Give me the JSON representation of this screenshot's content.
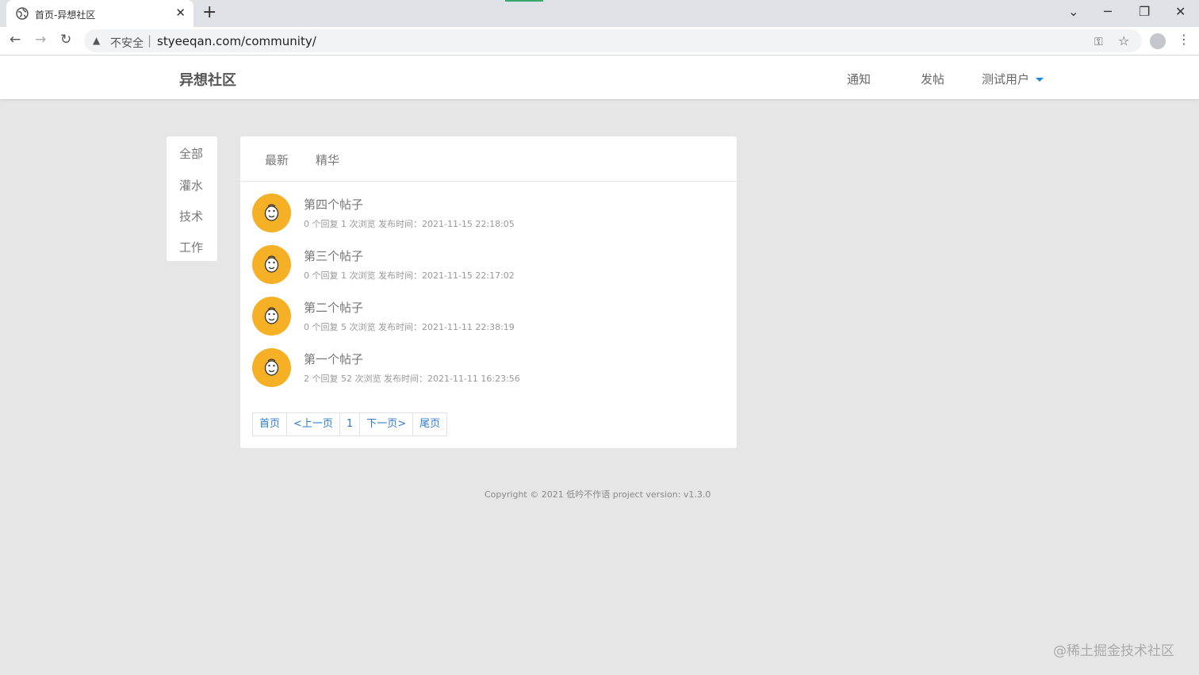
{
  "browser": {
    "tab_title": "首页-异想社区",
    "tab_close": "✕",
    "new_tab": "+",
    "security_label": "不安全",
    "url": "styeeqan.com/community/",
    "window_controls": {
      "dropdown": "⌄",
      "minimize": "─",
      "restore": "❐",
      "close": "✕"
    },
    "nav": {
      "back": "←",
      "forward": "→",
      "reload": "↻"
    },
    "icons": {
      "key": "key-icon",
      "star": "star-icon",
      "profile": "profile-icon",
      "menu": "menu-icon"
    }
  },
  "header": {
    "brand": "异想社区",
    "nav": [
      "通知",
      "发帖",
      "测试用户"
    ]
  },
  "sidebar": {
    "categories": [
      "全部",
      "灌水",
      "技术",
      "工作"
    ]
  },
  "main": {
    "tabs": [
      "最新",
      "精华"
    ],
    "posts": [
      {
        "title": "第四个帖子",
        "meta": "0 个回复  1 次浏览  发布时间：2021-11-15 22:18:05"
      },
      {
        "title": "第三个帖子",
        "meta": "0 个回复  1 次浏览  发布时间：2021-11-15 22:17:02"
      },
      {
        "title": "第二个帖子",
        "meta": "0 个回复  5 次浏览  发布时间：2021-11-11 22:38:19"
      },
      {
        "title": "第一个帖子",
        "meta": "2 个回复  52 次浏览  发布时间：2021-11-11 16:23:56"
      }
    ],
    "pagination": [
      "首页",
      "<上一页",
      "1",
      "下一页>",
      "尾页"
    ]
  },
  "footer": {
    "copyright": "Copyright © 2021 低吟不作语 project version: v1.3.0"
  },
  "watermark": "@稀土掘金技术社区",
  "colors": {
    "accent": "#2e7bd0",
    "avatar_bg": "#f5b026",
    "page_bg": "#e6e6e6"
  }
}
